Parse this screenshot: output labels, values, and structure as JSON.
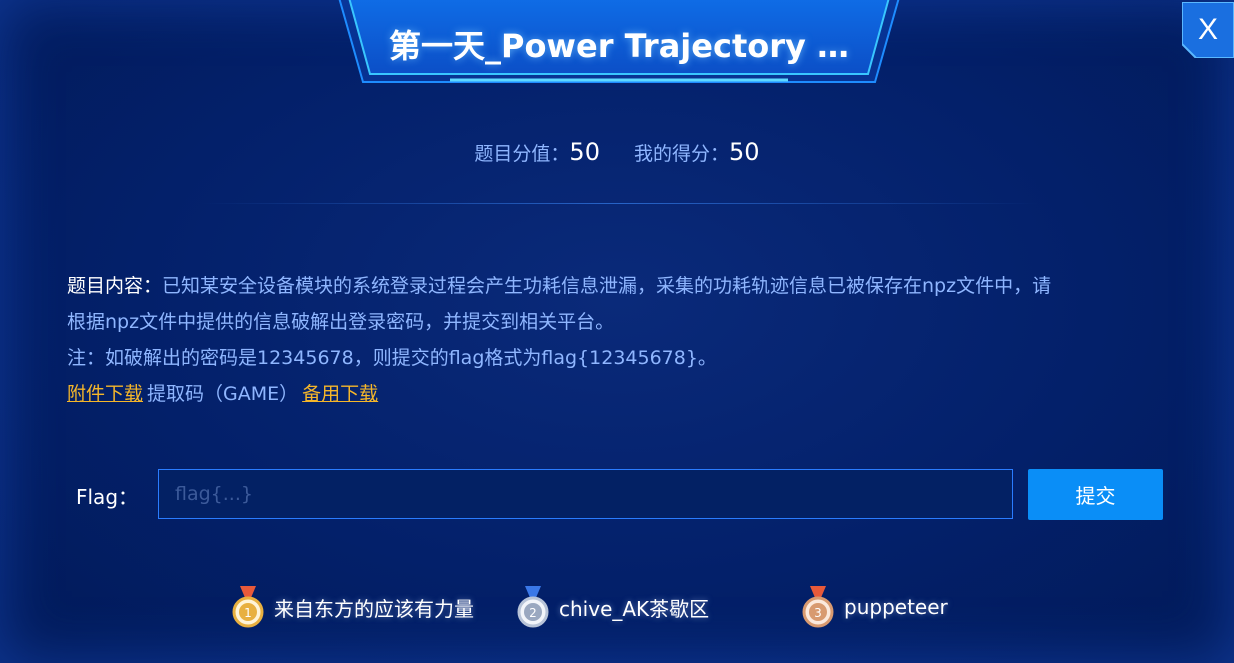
{
  "title": "第一天_Power Trajectory …",
  "close_label": "X",
  "score": {
    "total_label": "题目分值：",
    "total_value": "50",
    "mine_label": "我的得分：",
    "mine_value": "50"
  },
  "content": {
    "label": "题目内容：",
    "line1": "已知某安全设备模块的系统登录过程会产生功耗信息泄漏，采集的功耗轨迹信息已被保存在npz文件中，请",
    "line2": "根据npz文件中提供的信息破解出登录密码，并提交到相关平台。",
    "note": "注：如破解出的密码是12345678，则提交的flag格式为flag{12345678}。",
    "attachment_link": "附件下载",
    "extract_code": "提取码（GAME）",
    "backup_link": "备用下载"
  },
  "flag": {
    "label": "Flag：",
    "placeholder": "flag{...}",
    "value": "",
    "submit_label": "提交"
  },
  "leaderboard": [
    {
      "rank": "1",
      "name": "来自东方的应该有力量",
      "medal_color": "#e8b040"
    },
    {
      "rank": "2",
      "name": "chive_AK茶歇区",
      "medal_color": "#b8c4d8"
    },
    {
      "rank": "3",
      "name": "puppeteer",
      "medal_color": "#d89a70"
    }
  ],
  "colors": {
    "background": "#021c5e",
    "accent": "#0a8ef7",
    "link": "#f5b62a",
    "muted_text": "#8fb6ff"
  }
}
